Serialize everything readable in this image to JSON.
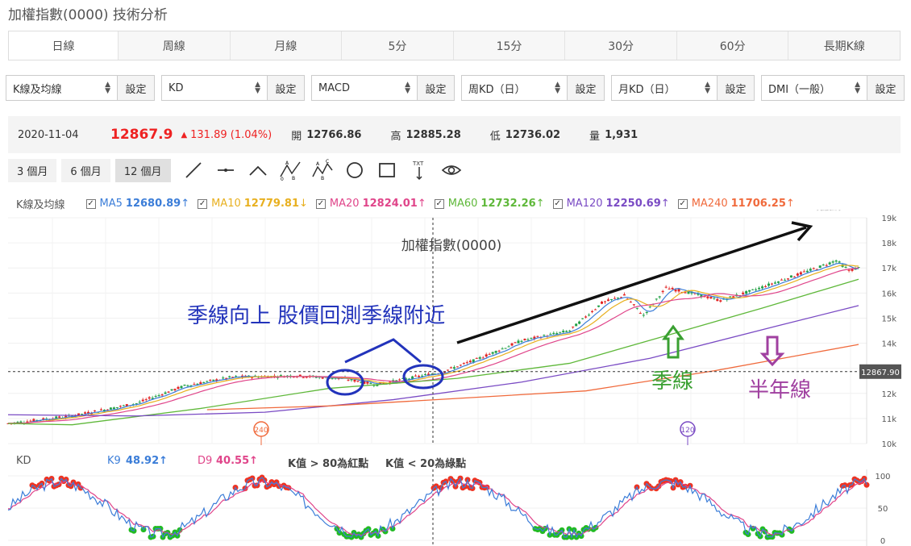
{
  "page_title": "加權指數(0000) 技術分析",
  "tabs": [
    "日線",
    "周線",
    "月線",
    "5分",
    "15分",
    "30分",
    "60分",
    "長期K線"
  ],
  "active_tab": 0,
  "selectors": [
    {
      "value": "K線及均線",
      "button": "設定",
      "width": 185
    },
    {
      "value": "KD",
      "button": "設定",
      "width": 178
    },
    {
      "value": "MACD",
      "button": "設定",
      "width": 178
    },
    {
      "value": "周KD（日）",
      "button": "設定",
      "width": 178
    },
    {
      "value": "月KD（日）",
      "button": "設定",
      "width": 178
    },
    {
      "value": "DMI（一般）",
      "button": "設定",
      "width": 178
    }
  ],
  "quote": {
    "date": "2020-11-04",
    "price": "12867.9",
    "change": "131.89 (1.04%)",
    "open_label": "開",
    "open": "12766.86",
    "high_label": "高",
    "high": "12885.28",
    "low_label": "低",
    "low": "12736.02",
    "vol_label": "量",
    "vol": "1,931"
  },
  "ranges": [
    "3 個月",
    "6 個月",
    "12 個月"
  ],
  "active_range": 2,
  "tools": [
    "line-tool-icon",
    "horizontal-line-icon",
    "angle-tool-icon",
    "abc-pattern-icon",
    "abcd-pattern-icon",
    "circle-tool-icon",
    "rectangle-tool-icon",
    "text-tool-icon",
    "eye-icon"
  ],
  "legend": {
    "section": "K線及均線",
    "items": [
      {
        "name": "MA5",
        "value": "12680.89",
        "arrow": "↑",
        "color": "#3b7dd8"
      },
      {
        "name": "MA10",
        "value": "12779.81",
        "arrow": "↓",
        "color": "#e8b020"
      },
      {
        "name": "MA20",
        "value": "12824.01",
        "arrow": "↑",
        "color": "#e0458a"
      },
      {
        "name": "MA60",
        "value": "12732.26",
        "arrow": "↑",
        "color": "#5fb83a"
      },
      {
        "name": "MA120",
        "value": "12250.69",
        "arrow": "↑",
        "color": "#7a4bc4"
      },
      {
        "name": "MA240",
        "value": "11706.25",
        "arrow": "↑",
        "color": "#f06a3c"
      }
    ]
  },
  "watermark": "玩股網",
  "colors": {
    "up": "#e22222",
    "down": "#22a045",
    "ma5": "#3b7dd8",
    "ma10": "#e8b020",
    "ma20": "#e0458a",
    "ma60": "#5fb83a",
    "ma120": "#7a4bc4",
    "ma240": "#f06a3c"
  },
  "chart_data": [
    {
      "type": "candlestick",
      "title": "加權指數(0000)",
      "y_ticks": [
        "19k",
        "18k",
        "17k",
        "16k",
        "15k",
        "14k",
        "13k",
        "12k",
        "11k",
        "10k"
      ],
      "ylim": [
        10000,
        19000
      ],
      "current_price_label": "12867.90",
      "current_price": 12867.9,
      "markers": [
        {
          "label": "240",
          "value": 11000,
          "color": "#f06a3c"
        },
        {
          "label": "120",
          "value": 11000,
          "color": "#7a4bc4"
        }
      ],
      "annotations": [
        {
          "text": "季線向上  股價回測季線附近",
          "color": "#2233bb"
        },
        {
          "text": "季線",
          "color": "#3aa032"
        },
        {
          "text": "半年線",
          "color": "#a040a0"
        }
      ],
      "ma60_end": 16550,
      "ma120_end": 15500,
      "ma240_end": 13950
    },
    {
      "type": "line",
      "title": "KD",
      "k_label": "K9",
      "k_value": "48.92↑",
      "d_label": "D9",
      "d_value": "40.55↑",
      "note1": "K值 > 80為紅點",
      "note2": "K值 < 20為綠點",
      "y_ticks": [
        "100",
        "50",
        "0"
      ],
      "ylim": [
        0,
        100
      ]
    }
  ]
}
